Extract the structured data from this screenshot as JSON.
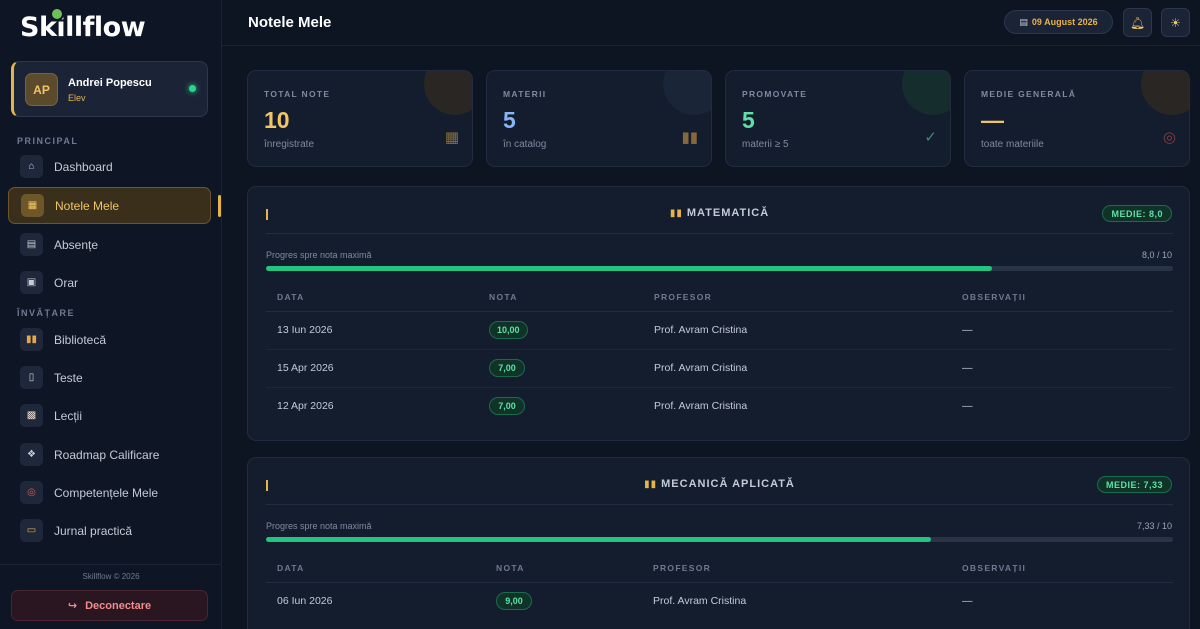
{
  "app": {
    "logo": "Skillflow",
    "copyright": "Skillflow © 2026",
    "logout_label": "Deconectare"
  },
  "profile": {
    "initials": "AP",
    "name": "Andrei Popescu",
    "role": "Elev"
  },
  "sidebar": {
    "sections": {
      "principal": "PRINCIPAL",
      "invatare": "ÎNVĂȚARE"
    },
    "items": [
      {
        "label": "Dashboard",
        "icon": "home-icon"
      },
      {
        "label": "Notele Mele",
        "icon": "grades-icon",
        "active": true
      },
      {
        "label": "Absențe",
        "icon": "calendar-icon"
      },
      {
        "label": "Orar",
        "icon": "schedule-icon"
      },
      {
        "label": "Bibliotecă",
        "icon": "books-icon"
      },
      {
        "label": "Teste",
        "icon": "phone-icon"
      },
      {
        "label": "Lecții",
        "icon": "book-open-icon"
      },
      {
        "label": "Roadmap Calificare",
        "icon": "map-icon"
      },
      {
        "label": "Competențele Mele",
        "icon": "target-icon"
      },
      {
        "label": "Jurnal practică",
        "icon": "journal-icon"
      }
    ]
  },
  "header": {
    "title": "Notele Mele",
    "date": "09 August 2026"
  },
  "stats": [
    {
      "label": "TOTAL NOTE",
      "value": "10",
      "sub": "înregistrate",
      "color": "#f0c566",
      "icon": "bar-chart-icon"
    },
    {
      "label": "MATERII",
      "value": "5",
      "sub": "în catalog",
      "color": "#8ab4f8",
      "icon": "books-icon"
    },
    {
      "label": "PROMOVATE",
      "value": "5",
      "sub": "materii ≥ 5",
      "color": "#5fe0a8",
      "icon": "check-icon"
    },
    {
      "label": "MEDIE GENERALĂ",
      "value": "—",
      "sub": "toate materiile",
      "color": "#f0c566",
      "icon": "target-icon"
    }
  ],
  "table_headers": {
    "date": "DATA",
    "grade": "NOTA",
    "teacher": "PROFESOR",
    "notes": "OBSERVAȚII"
  },
  "subjects": [
    {
      "name": "MATEMATICĂ",
      "average": "MEDIE: 8,0",
      "progress_label": "Progres spre nota maximă",
      "progress_text": "8,0 / 10",
      "progress_fraction": 0.8,
      "rows": [
        {
          "date": "13 Iun 2026",
          "grade": "10,00",
          "teacher": "Prof. Avram Cristina",
          "notes": "—"
        },
        {
          "date": "15 Apr 2026",
          "grade": "7,00",
          "teacher": "Prof. Avram Cristina",
          "notes": "—"
        },
        {
          "date": "12 Apr 2026",
          "grade": "7,00",
          "teacher": "Prof. Avram Cristina",
          "notes": "—"
        }
      ]
    },
    {
      "name": "MECANICĂ APLICATĂ",
      "average": "MEDIE: 7,33",
      "progress_label": "Progres spre nota maximă",
      "progress_text": "7,33 / 10",
      "progress_fraction": 0.733,
      "rows": [
        {
          "date": "06 Iun 2026",
          "grade": "9,00",
          "teacher": "Prof. Avram Cristina",
          "notes": "—"
        }
      ]
    }
  ]
}
